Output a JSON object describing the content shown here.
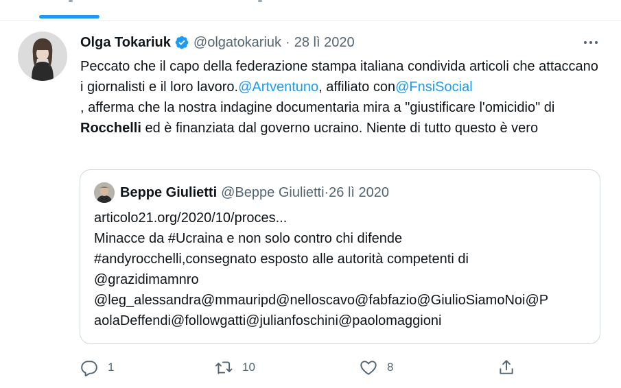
{
  "tweet": {
    "author_name": "Olga Tokariuk",
    "handle": "@olgatokariuk",
    "separator": "·",
    "date": "28 lì 2020",
    "text": {
      "p1": "Peccato che il capo della federazione stampa italiana condivida articoli che attaccano i giornalisti e il loro lavoro.",
      "m1": "@Artventuno",
      "p2": ", affiliato con",
      "m2": "@FnsiSocial",
      "p3": ", afferma che la nostra indagine documentaria mira a \"giustificare l'omicidio\" di ",
      "bold": "Rocchelli",
      "p4": " ed è finanziata dal governo ucraino. Niente di tutto questo è vero"
    }
  },
  "quote": {
    "author_name": "Beppe Giulietti",
    "handle": "@Beppe Giulietti",
    "date": "·26 lì 2020",
    "line1": "articolo21.org/2020/10/proces...",
    "line2": "Minacce da #Ucraina e non solo contro chi difende",
    "line3": "#andyrocchelli,consegnato esposto alle autorità competenti di",
    "line4": "@grazidimamnro",
    "line5": "@leg_alessandra@mmauripd@nelloscavo@fabfazio@GiulioSiamoNoi@P",
    "line6": "aolaDeffendi@followgatti@julianfoschini@paolomaggioni"
  },
  "actions": {
    "reply_count": "1",
    "retweet_count": "10",
    "like_count": "8"
  },
  "colors": {
    "accent": "#1d9bf0",
    "text": "#0f1419",
    "muted": "#536471",
    "border": "#cfd9de"
  },
  "icons": [
    "verified-badge-icon",
    "more-options-icon",
    "reply-icon",
    "retweet-icon",
    "like-icon",
    "share-icon"
  ]
}
